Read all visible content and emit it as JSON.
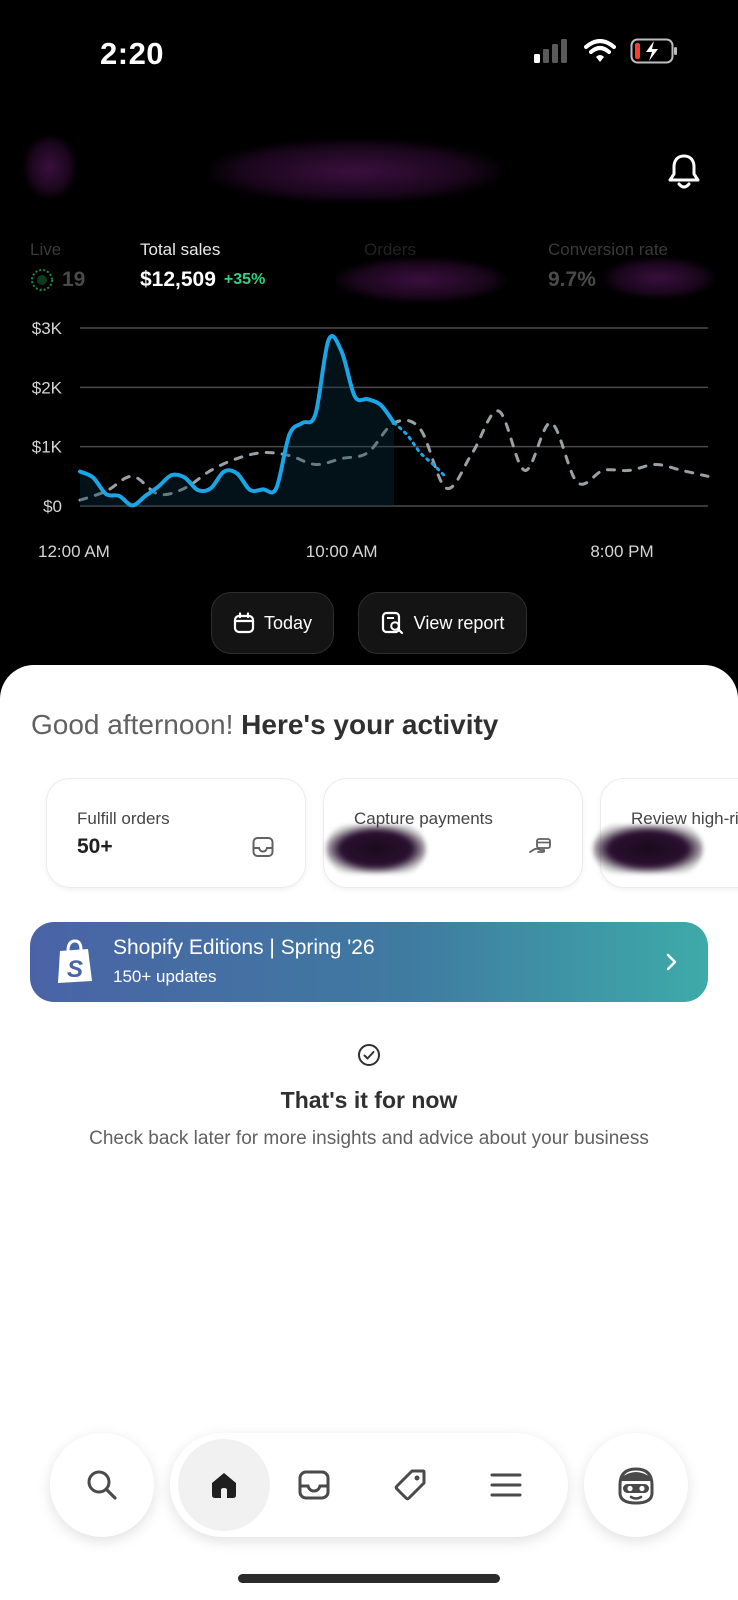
{
  "status_bar": {
    "time": "2:20"
  },
  "metrics": {
    "live": {
      "label": "Live",
      "value": "19"
    },
    "total_sales": {
      "label": "Total sales",
      "value": "$12,509",
      "delta": "+35%"
    },
    "orders": {
      "label": "Orders"
    },
    "conversion": {
      "label": "Conversion rate",
      "value": "9.7%"
    }
  },
  "chart_data": {
    "type": "line",
    "y_ticks": [
      "$3K",
      "$2K",
      "$1K",
      "$0"
    ],
    "x_ticks": [
      "12:00 AM",
      "10:00 AM",
      "8:00 PM"
    ],
    "ylim": [
      0,
      3000
    ],
    "grid": true,
    "series": [
      {
        "style": "solid",
        "color": "#1aa6e6",
        "x": [
          0,
          0.5,
          1,
          1.5,
          2,
          2.5,
          3,
          3.5,
          4,
          4.5,
          5,
          5.5,
          6,
          6.5,
          7,
          7.5,
          8,
          8.5,
          9,
          9.5,
          10,
          10.5,
          11,
          11.5,
          12,
          12.5,
          13,
          13.5,
          14
        ],
        "values": [
          580,
          480,
          200,
          170,
          10,
          170,
          330,
          520,
          480,
          270,
          300,
          580,
          550,
          270,
          280,
          300,
          1200,
          1400,
          1550,
          2800,
          2600,
          1850,
          1800,
          1700,
          1400,
          1200,
          900,
          700,
          480
        ]
      },
      {
        "style": "dashed",
        "color": "#a8b3b8",
        "x": [
          0,
          1,
          2,
          3,
          4,
          5,
          6,
          7,
          8,
          9,
          10,
          11,
          12,
          13,
          14,
          15,
          16,
          17,
          18,
          19,
          20,
          21,
          22,
          23,
          24
        ],
        "values": [
          100,
          250,
          500,
          200,
          300,
          600,
          800,
          900,
          850,
          700,
          800,
          900,
          1400,
          1300,
          300,
          900,
          1600,
          600,
          1400,
          400,
          600,
          600,
          700,
          600,
          500
        ]
      }
    ]
  },
  "actions": {
    "today": "Today",
    "view_report": "View report"
  },
  "greeting": {
    "lead": "Good afternoon!",
    "rest": "Here's your activity"
  },
  "cards": [
    {
      "title": "Fulfill orders",
      "value": "50+",
      "icon": "inbox-icon"
    },
    {
      "title": "Capture payments",
      "value": "",
      "icon": "payment-hand-icon"
    },
    {
      "title": "Review high-risk orders",
      "value": "",
      "icon": ""
    }
  ],
  "banner": {
    "title": "Shopify Editions | Spring '26",
    "subtitle": "150+ updates"
  },
  "empty_state": {
    "title": "That's it for now",
    "subtitle": "Check back later for more insights and advice about your business"
  },
  "tabs": [
    "search-icon",
    "home-icon",
    "inbox-icon",
    "tag-icon",
    "menu-icon",
    "avatar"
  ],
  "colors": {
    "accent_line": "#1aa6e6",
    "positive": "#2fd17c",
    "banner_start": "#4a63a6",
    "banner_end": "#3eaaa9"
  }
}
